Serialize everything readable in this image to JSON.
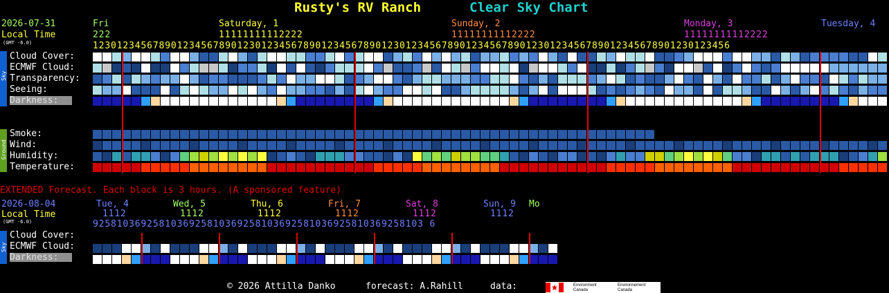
{
  "header": {
    "site_title": "Rusty's RV Ranch",
    "chart_title": "Clear Sky Chart",
    "date": "2026-07-31",
    "local_time": "Local Time",
    "gmt": "(GMT -6.0)"
  },
  "days": [
    {
      "label": "Fri",
      "color": "#a0ff60"
    },
    {
      "label": "Saturday, 1",
      "color": "#ffff40"
    },
    {
      "label": "Sunday, 2",
      "color": "#ff8c40"
    },
    {
      "label": "Monday, 3",
      "color": "#e040e0"
    },
    {
      "label": "Tuesday, 4",
      "color": "#7080ff"
    }
  ],
  "hours": {
    "tens": [
      "2",
      "2",
      "2",
      " ",
      " ",
      " ",
      " ",
      " ",
      " ",
      " ",
      " ",
      " ",
      " ",
      " ",
      " ",
      " ",
      " ",
      " ",
      " ",
      "1",
      "1",
      "1",
      "1",
      "1",
      "1",
      "1",
      "1",
      "1",
      "1",
      "1",
      "1",
      "1",
      "1"
    ],
    "ones": [
      1,
      2,
      3,
      0,
      1,
      2,
      3,
      4,
      5,
      6,
      7,
      8,
      9,
      0,
      1,
      2,
      3,
      4,
      5,
      6,
      7,
      8,
      9,
      0,
      1,
      2,
      3,
      4,
      5,
      6,
      7,
      8,
      9,
      0,
      1,
      2,
      3,
      4,
      5,
      6,
      7,
      8,
      9,
      0,
      1,
      2,
      3,
      4,
      5,
      6,
      7,
      8,
      9,
      0,
      1,
      2,
      3,
      4,
      5,
      6,
      7,
      8,
      9,
      0,
      1,
      2,
      3,
      4,
      5,
      6,
      7,
      8,
      9,
      0,
      1,
      2,
      3,
      4,
      5,
      6,
      7,
      8,
      9,
      0,
      1,
      2,
      3,
      4,
      5,
      6,
      7,
      8,
      9,
      0,
      1,
      2,
      3,
      4,
      5,
      6,
      7,
      8,
      9,
      0,
      1,
      2,
      3,
      4,
      5,
      6
    ],
    "ones_text": "1230123456789012345678901230123456789012345678901230123456789012345678901230123456789012345678901230123456"
  },
  "sky_rows": [
    {
      "label": "Cloud Cover:"
    },
    {
      "label": "ECMWF Cloud:"
    },
    {
      "label": "Transparency:"
    },
    {
      "label": "Seeing:"
    },
    {
      "label": "Darkness:"
    }
  ],
  "ground_rows": [
    {
      "label": "Smoke:"
    },
    {
      "label": "Wind:"
    },
    {
      "label": "Humidity:"
    },
    {
      "label": "Temperature:"
    }
  ],
  "side_labels": {
    "sky": "Sky",
    "ground": "Ground"
  },
  "extended": {
    "notice": "EXTENDED Forecast. Each block is 3 hours. (A sponsored feature)",
    "date": "2026-08-04",
    "local_time": "Local Time",
    "gmt": "(GMT -6.0)",
    "days": [
      {
        "label": "Tue, 4",
        "color": "#7080ff"
      },
      {
        "label": "Wed, 5",
        "color": "#a0ff60"
      },
      {
        "label": "Thu, 6",
        "color": "#ffff40"
      },
      {
        "label": "Fri, 7",
        "color": "#ff8c40"
      },
      {
        "label": "Sat, 8",
        "color": "#e040e0"
      },
      {
        "label": "Sun, 9",
        "color": "#7080ff"
      },
      {
        "label": "Mo",
        "color": "#a0ff60"
      }
    ],
    "tens_text": "1112",
    "ones_text": "9258103692581036925810369258103692581036925810369258103 6",
    "rows": [
      {
        "label": "Cloud Cover:"
      },
      {
        "label": "ECMWF Cloud:"
      },
      {
        "label": "Darkness:"
      }
    ]
  },
  "footer": {
    "copyright": "© 2026 Attilla Danko",
    "forecast": "forecast: A.Rahill",
    "data": "data:",
    "env_en": "Environment Canada",
    "env_fr": "Environnement Canada"
  },
  "colors": {
    "bg": "#000000",
    "navy": "#1a3e7a",
    "blue": "#2a5aa6",
    "mid": "#4a7ed0",
    "light": "#7ab0e6",
    "pale": "#b0e0e6",
    "white": "#ffffff",
    "grey": "#c8c8c8",
    "red": "#e00000"
  }
}
